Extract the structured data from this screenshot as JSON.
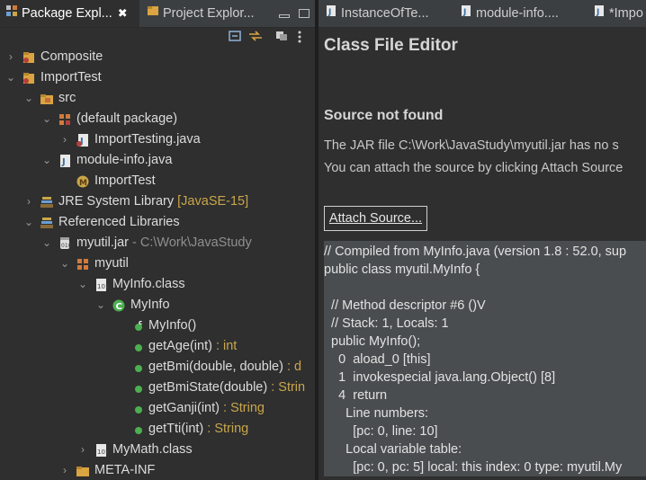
{
  "left_panel": {
    "tabs": [
      {
        "label": "Package Expl..."
      },
      {
        "label": "Project Explor..."
      }
    ],
    "tree": [
      {
        "label": "Composite",
        "decor": ""
      },
      {
        "label": "ImportTest",
        "decor": ""
      },
      {
        "label": "src",
        "decor": ""
      },
      {
        "label": "(default package)",
        "decor": ""
      },
      {
        "label": "ImportTesting.java",
        "decor": ""
      },
      {
        "label": "module-info.java",
        "decor": ""
      },
      {
        "label": "ImportTest",
        "decor": ""
      },
      {
        "label": "JRE System Library",
        "decor": "[JavaSE-15]"
      },
      {
        "label": "Referenced Libraries",
        "decor": ""
      },
      {
        "label": "myutil.jar",
        "decor": "- C:\\Work\\JavaStudy"
      },
      {
        "label": "myutil",
        "decor": ""
      },
      {
        "label": "MyInfo.class",
        "decor": ""
      },
      {
        "label": "MyInfo",
        "decor": ""
      },
      {
        "label": "MyInfo()",
        "decor": ""
      },
      {
        "label": "getAge(int)",
        "decor": ": int"
      },
      {
        "label": "getBmi(double, double)",
        "decor": ": d"
      },
      {
        "label": "getBmiState(double)",
        "decor": ": Strin"
      },
      {
        "label": "getGanji(int)",
        "decor": ": String"
      },
      {
        "label": "getTti(int)",
        "decor": ": String"
      },
      {
        "label": "MyMath.class",
        "decor": ""
      },
      {
        "label": "META-INF",
        "decor": ""
      }
    ]
  },
  "right_panel": {
    "tabs": [
      {
        "label": "InstanceOfTe..."
      },
      {
        "label": "module-info...."
      },
      {
        "label": "*Impo"
      }
    ],
    "title": "Class File Editor",
    "section_title": "Source not found",
    "message_line1": "The JAR file C:\\Work\\JavaStudy\\myutil.jar has no s",
    "message_line2": "You can attach the source by clicking Attach Source",
    "attach_button": "Attach Source...",
    "code_lines": [
      "// Compiled from MyInfo.java (version 1.8 : 52.0, sup",
      "public class myutil.MyInfo {",
      "",
      "  // Method descriptor #6 ()V",
      "  // Stack: 1, Locals: 1",
      "  public MyInfo();",
      "    0  aload_0 [this]",
      "    1  invokespecial java.lang.Object() [8]",
      "    4  return",
      "      Line numbers:",
      "        [pc: 0, line: 10]",
      "      Local variable table:",
      "        [pc: 0, pc: 5] local: this index: 0 type: myutil.My"
    ]
  },
  "colors": {
    "background": "#2f2f2f",
    "decoration": "#c9a64a",
    "code_background": "#4a4d4f"
  }
}
